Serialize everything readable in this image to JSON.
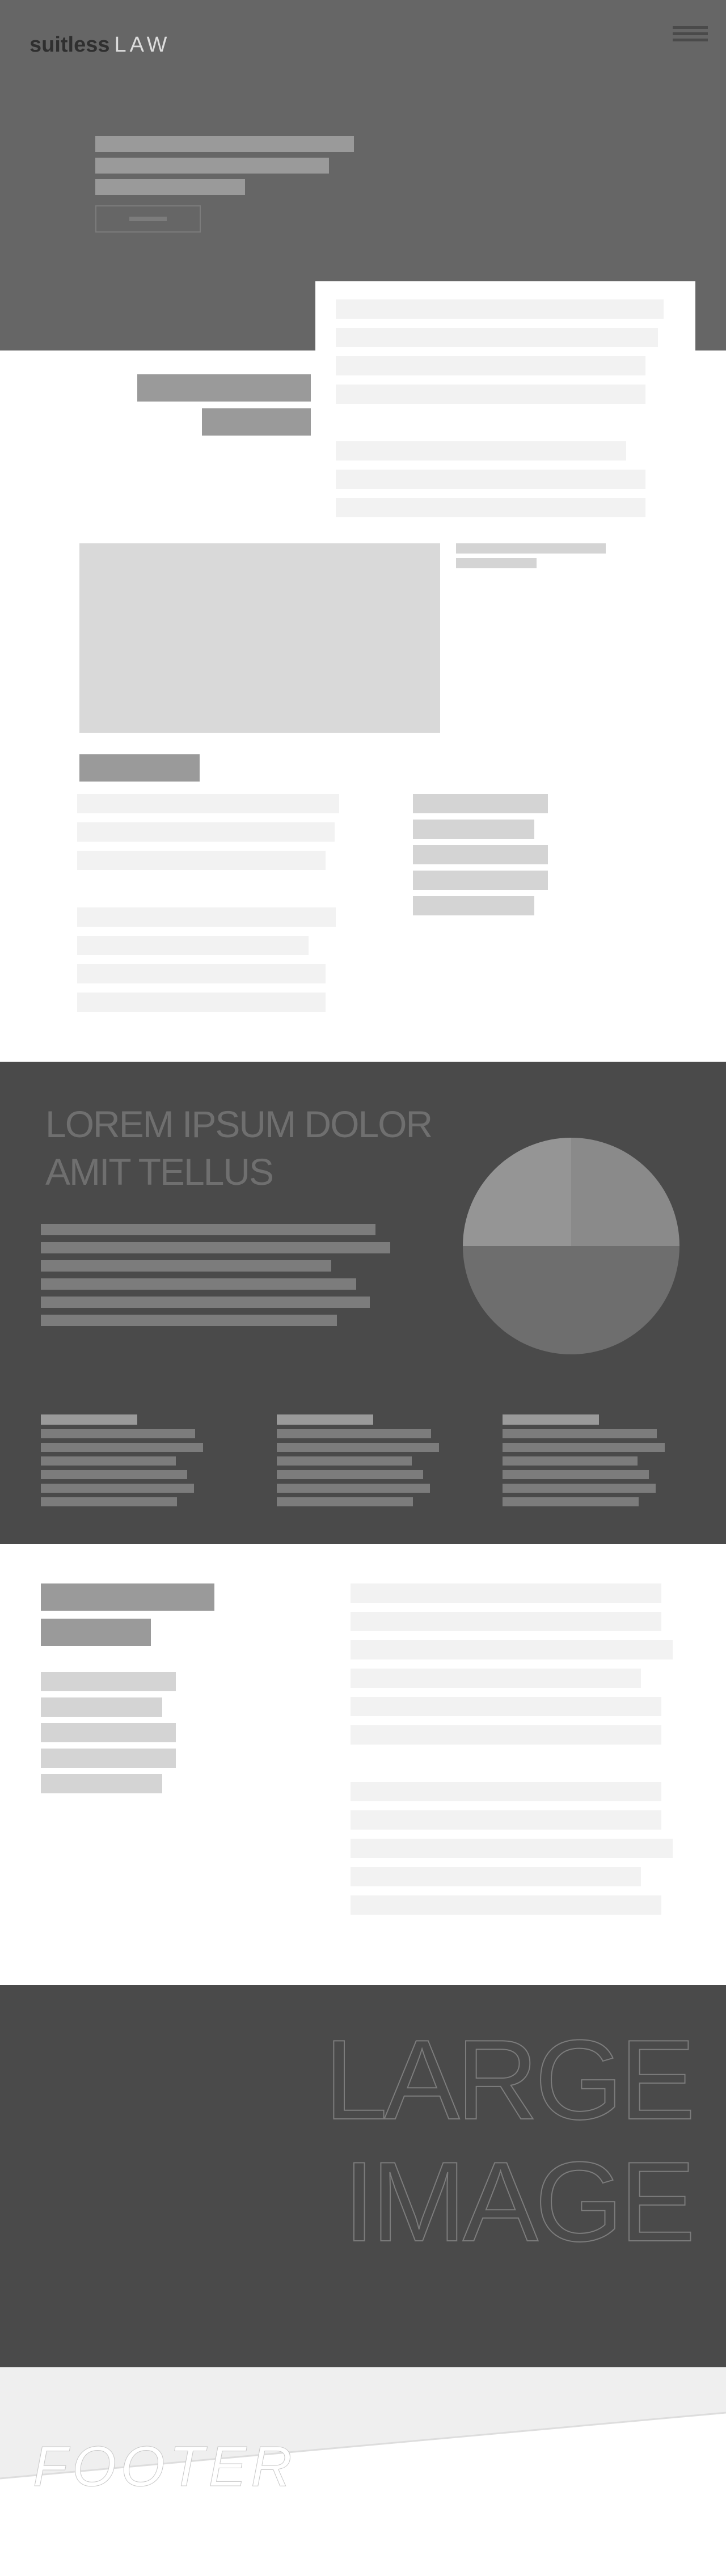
{
  "header": {
    "brand_bold": "suitless",
    "brand_light": "LAW",
    "menu_icon": "hamburger-menu-icon"
  },
  "dark_section": {
    "title": "LOREM IPSUM DOLOR\nAMIT TELLUS",
    "chart_icon": "pie-chart-icon"
  },
  "large_image": {
    "label": "LARGE\nIMAGE"
  },
  "footer": {
    "label": "FOOTER"
  },
  "colors": {
    "hero_bg": "#666666",
    "dark_bg": "#4a4a4a",
    "placeholder_light": "#f2f2f2",
    "placeholder_mid": "#9a9a9a",
    "footer_bg": "#efefef"
  }
}
